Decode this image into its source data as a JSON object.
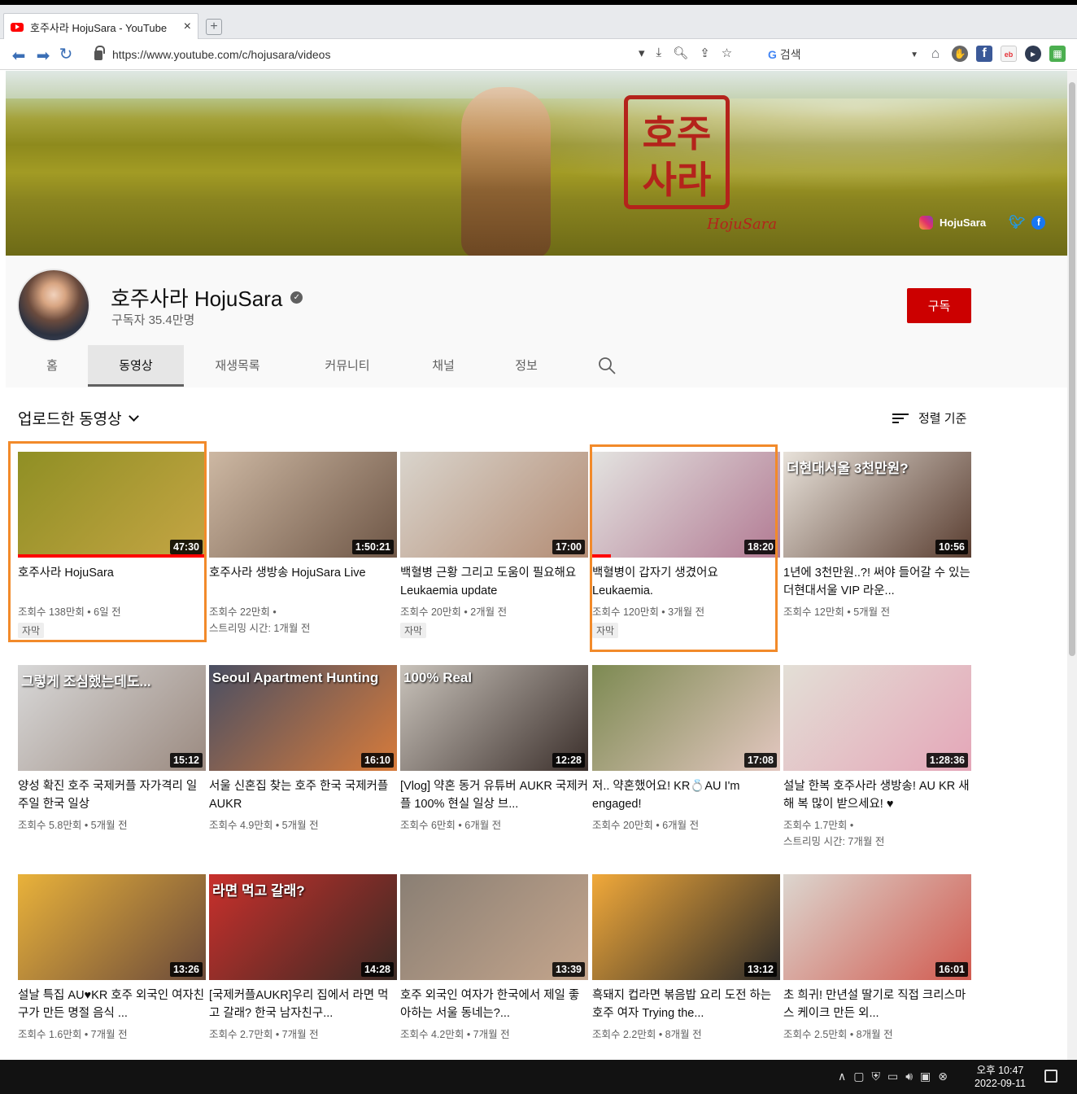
{
  "browser": {
    "tab_title": "호주사라 HojuSara - YouTube",
    "tab_close": "×",
    "new_tab": "+",
    "url": "https://www.youtube.com/c/hojusara/videos",
    "search_placeholder": "검색",
    "search_engine": "G"
  },
  "banner": {
    "seal_text": "호주사라",
    "signature": "HojuSara",
    "instagram_label": "HojuSara"
  },
  "channel": {
    "name": "호주사라 HojuSara",
    "subscribers": "구독자 35.4만명",
    "subscribe_label": "구독",
    "tabs": [
      "홈",
      "동영상",
      "재생목록",
      "커뮤니티",
      "채널",
      "정보"
    ],
    "active_tab": "동영상"
  },
  "section": {
    "title": "업로드한 동영상",
    "sort_label": "정렬 기준"
  },
  "videos": [
    {
      "title": "호주사라 HojuSara",
      "meta1": "조회수 138만회 • 6일 전",
      "meta2": "",
      "duration": "47:30",
      "badge": "자막",
      "thumb_colors": [
        "#8f8f24",
        "#c5a544"
      ],
      "overlay": "",
      "progress": 1.0
    },
    {
      "title": "호주사라 생방송 HojuSara Live",
      "meta1": "조회수 22만회 •",
      "meta2": "스트리밍 시간: 1개월 전",
      "duration": "1:50:21",
      "badge": "",
      "thumb_colors": [
        "#cdb8a3",
        "#6e5646"
      ],
      "overlay": "",
      "progress": 0
    },
    {
      "title": "백혈병 근황 그리고 도움이 필요해요 Leukaemia update",
      "meta1": "조회수 20만회 • 2개월 전",
      "meta2": "",
      "duration": "17:00",
      "badge": "자막",
      "thumb_colors": [
        "#d9d4cc",
        "#b38c74"
      ],
      "overlay": "",
      "progress": 0
    },
    {
      "title": "백혈병이 갑자기 생겼어요 Leukaemia.",
      "meta1": "조회수 120만회 • 3개월 전",
      "meta2": "",
      "duration": "18:20",
      "badge": "자막",
      "thumb_colors": [
        "#e3e3e0",
        "#b27a93"
      ],
      "overlay": "",
      "progress": 0.1
    },
    {
      "title": "1년에 3천만원..?! 써야 들어갈 수 있는 더현대서울 VIP 라운...",
      "meta1": "조회수 12만회 • 5개월 전",
      "meta2": "",
      "duration": "10:56",
      "badge": "",
      "thumb_colors": [
        "#e8e2da",
        "#5a3e31"
      ],
      "overlay": "더현대서울 3천만원?",
      "progress": 0
    },
    {
      "title": "양성 확진 호주 국제커플 자가격리 일주일 한국 일상",
      "meta1": "조회수 5.8만회 • 5개월 전",
      "meta2": "",
      "duration": "15:12",
      "badge": "",
      "thumb_colors": [
        "#d8d8d8",
        "#9b8a80"
      ],
      "overlay": "그렇게 조심했는데도...",
      "progress": 0
    },
    {
      "title": "서울 신혼집 찾는 호주 한국 국제커플 AUKR",
      "meta1": "조회수 4.9만회 • 5개월 전",
      "meta2": "",
      "duration": "16:10",
      "badge": "",
      "thumb_colors": [
        "#4a4f63",
        "#d77b3b"
      ],
      "overlay": "Seoul Apartment Hunting",
      "progress": 0
    },
    {
      "title": "[Vlog] 약혼 동거 유튜버 AUKR 국제커플 100% 현실 일상 브...",
      "meta1": "조회수 6만회 • 6개월 전",
      "meta2": "",
      "duration": "12:28",
      "badge": "",
      "thumb_colors": [
        "#c9c3bb",
        "#3b2f2b"
      ],
      "overlay": "100% Real",
      "progress": 0
    },
    {
      "title": "저.. 약혼했어요! KR💍AU I'm engaged!",
      "meta1": "조회수 20만회 • 6개월 전",
      "meta2": "",
      "duration": "17:08",
      "badge": "",
      "thumb_colors": [
        "#7d8a52",
        "#e3c7c0"
      ],
      "overlay": "",
      "progress": 0
    },
    {
      "title": "설날 한복 호주사라 생방송! AU KR 새해 복 많이 받으세요! ♥",
      "meta1": "조회수 1.7만회 •",
      "meta2": "스트리밍 시간: 7개월 전",
      "duration": "1:28:36",
      "badge": "",
      "thumb_colors": [
        "#e3dfd6",
        "#e4a6b8"
      ],
      "overlay": "",
      "progress": 0
    },
    {
      "title": "설날 특집 AU♥KR 호주 외국인 여자친구가 만든 명절 음식 ...",
      "meta1": "조회수 1.6만회 • 7개월 전",
      "meta2": "",
      "duration": "13:26",
      "badge": "",
      "thumb_colors": [
        "#e9b23a",
        "#6b4a3a"
      ],
      "overlay": "",
      "progress": 0
    },
    {
      "title": "[국제커플AUKR]우리 집에서 라면 먹고 갈래? 한국 남자친구...",
      "meta1": "조회수 2.7만회 • 7개월 전",
      "meta2": "",
      "duration": "14:28",
      "badge": "",
      "thumb_colors": [
        "#c9302c",
        "#3a2a24"
      ],
      "overlay": "라면 먹고 갈래?",
      "progress": 0
    },
    {
      "title": "호주 외국인 여자가 한국에서 제일 좋아하는 서울 동네는?...",
      "meta1": "조회수 4.2만회 • 7개월 전",
      "meta2": "",
      "duration": "13:39",
      "badge": "",
      "thumb_colors": [
        "#8a7f74",
        "#c4a58c"
      ],
      "overlay": "",
      "progress": 0
    },
    {
      "title": "흑돼지 컵라면 볶음밥 요리 도전 하는 호주 여자 Trying the...",
      "meta1": "조회수 2.2만회 • 8개월 전",
      "meta2": "",
      "duration": "13:12",
      "badge": "",
      "thumb_colors": [
        "#f1a93a",
        "#2d2a28"
      ],
      "overlay": "",
      "progress": 0
    },
    {
      "title": "초 희귀! 만년설 딸기로 직접 크리스마스 케이크 만든 외...",
      "meta1": "조회수 2.5만회 • 8개월 전",
      "meta2": "",
      "duration": "16:01",
      "badge": "",
      "thumb_colors": [
        "#dcd6cf",
        "#d15a4f"
      ],
      "overlay": "",
      "progress": 0
    }
  ],
  "taskbar": {
    "time": "오후 10:47",
    "date": "2022-09-11"
  }
}
